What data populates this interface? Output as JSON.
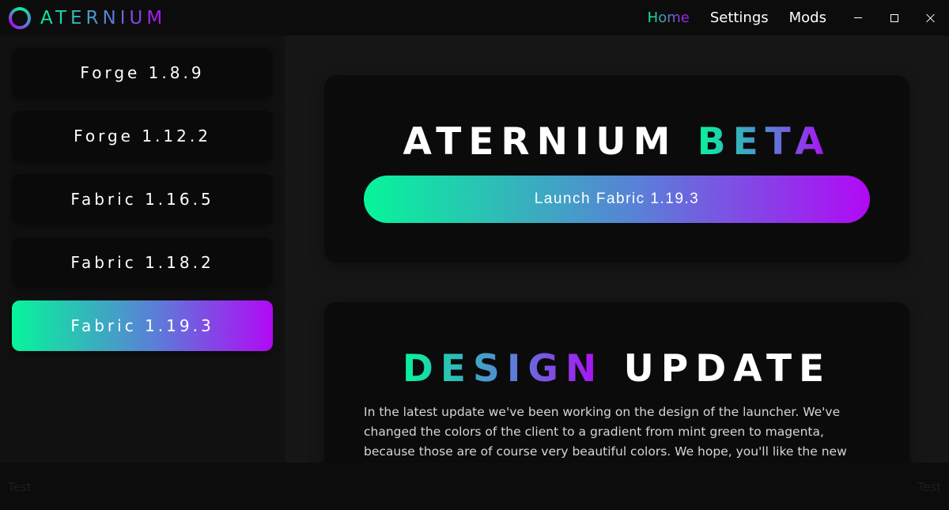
{
  "app": {
    "name": "ATERNIUM"
  },
  "nav": {
    "items": [
      {
        "label": "Home"
      },
      {
        "label": "Settings"
      },
      {
        "label": "Mods"
      }
    ],
    "active": "Home"
  },
  "sidebar": {
    "versions": [
      {
        "label": "Forge 1.8.9"
      },
      {
        "label": "Forge 1.12.2"
      },
      {
        "label": "Fabric 1.16.5"
      },
      {
        "label": "Fabric 1.18.2"
      },
      {
        "label": "Fabric 1.19.3"
      }
    ],
    "selected": "Fabric 1.19.3"
  },
  "launch_card": {
    "title_plain": "ATERNIUM",
    "title_accent": "BETA",
    "launch_label": "Launch Fabric 1.19.3"
  },
  "news_card": {
    "title_accent": "DESIGN",
    "title_plain": "UPDATE",
    "body": "In the latest update we've been working on the design of the launcher. We've changed the colors of the client to a gradient from mint green to magenta, because those are of course very beautiful colors. We hope, you'll like the new"
  },
  "footer": {
    "left_text": "Test",
    "right_text": "Test"
  },
  "colors": {
    "gradient_start": "#06f59a",
    "gradient_mid": "#5b7ed8",
    "gradient_end": "#b109f5",
    "background": "#161616",
    "panel": "#0b0b0b"
  },
  "icons": {
    "logo": "ring-logo-icon",
    "minimize": "minimize-icon",
    "maximize": "maximize-icon",
    "close": "close-icon"
  }
}
